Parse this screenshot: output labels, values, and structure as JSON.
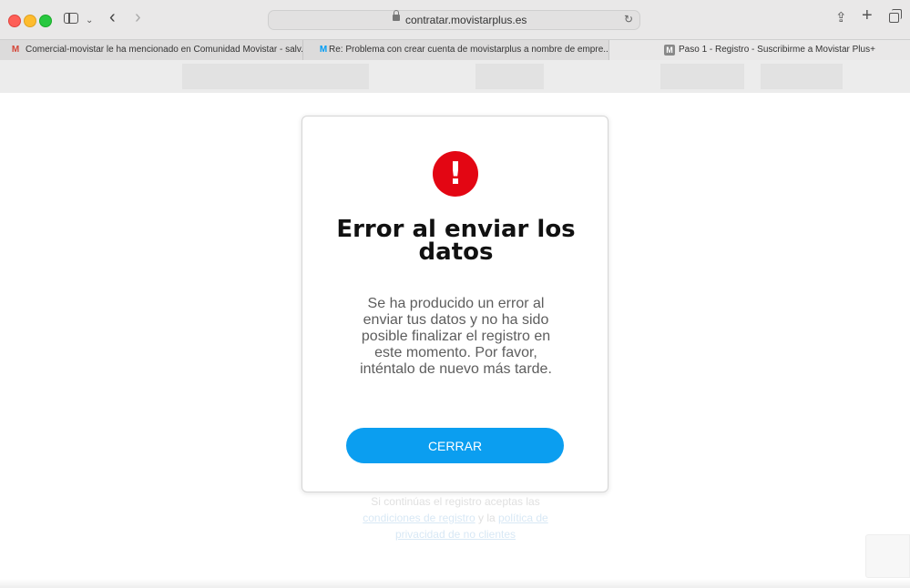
{
  "browser": {
    "url": "contratar.movistarplus.es",
    "tabs": [
      {
        "label": "Comercial-movistar le ha mencionado en Comunidad Movistar - salv...",
        "icon": "gmail-icon"
      },
      {
        "label": "Re: Problema con crear cuenta de movistarplus a nombre de empre...",
        "icon": "movistar-icon"
      },
      {
        "label": "Paso 1 - Registro - Suscribirme a Movistar Plus+",
        "icon": "m-icon"
      }
    ]
  },
  "modal": {
    "title": "Error al enviar los datos",
    "message": "Se ha producido un error al enviar tus datos y no ha sido posible finalizar el registro en este momento. Por favor, inténtalo de nuevo más tarde.",
    "close_label": "CERRAR"
  },
  "page": {
    "footer_prefix": "Si continúas el registro aceptas las",
    "footer_link1": "condiciones de registro",
    "footer_middle": "y la",
    "footer_link2": "política de privacidad de no clientes"
  },
  "colors": {
    "error_red": "#e30613",
    "button_blue": "#0b9ef0"
  }
}
